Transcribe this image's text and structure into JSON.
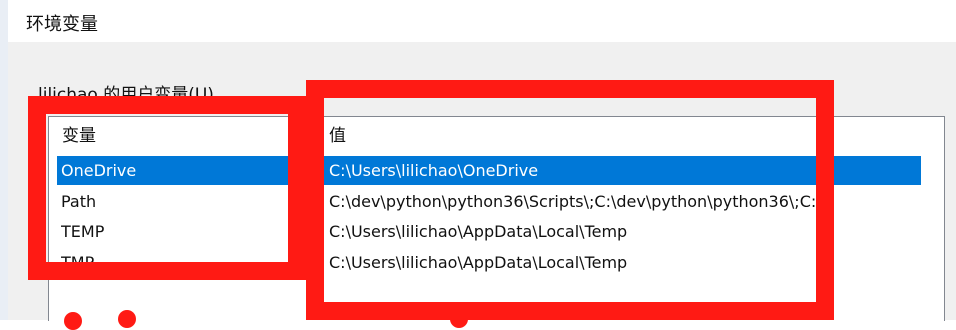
{
  "window": {
    "title": "环境变量"
  },
  "user_vars": {
    "group_label": "lilichao 的用户变量(U)",
    "columns": {
      "variable": "变量",
      "value": "值"
    },
    "rows": [
      {
        "name": "OneDrive",
        "value": "C:\\Users\\lilichao\\OneDrive",
        "selected": true
      },
      {
        "name": "Path",
        "value": "C:\\dev\\python\\python36\\Scripts\\;C:\\dev\\python\\python36\\;C:...",
        "selected": false
      },
      {
        "name": "TEMP",
        "value": "C:\\Users\\lilichao\\AppData\\Local\\Temp",
        "selected": false
      },
      {
        "name": "TMP",
        "value": "C:\\Users\\lilichao\\AppData\\Local\\Temp",
        "selected": false
      }
    ]
  },
  "colors": {
    "selection": "#0078d7",
    "annotation": "#ff1a14",
    "dialog_bg": "#f0f0f0"
  }
}
